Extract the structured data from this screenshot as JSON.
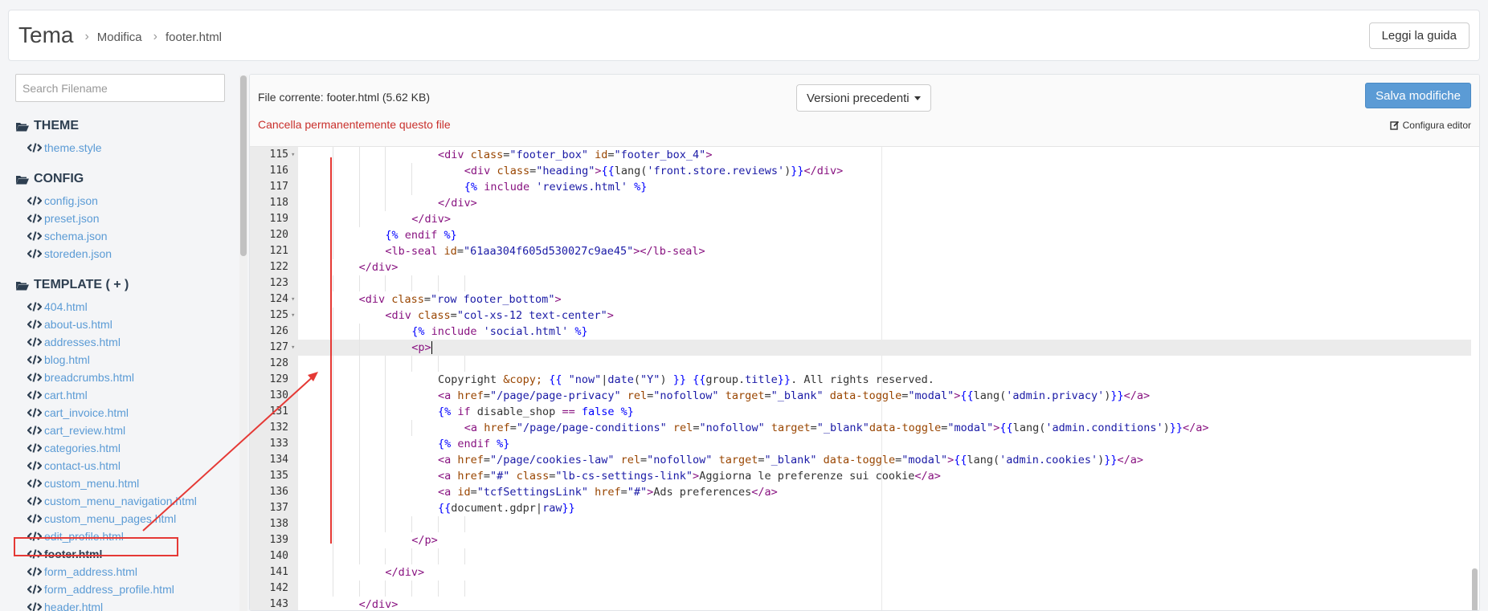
{
  "header": {
    "title": "Tema",
    "breadcrumb": [
      "Modifica",
      "footer.html"
    ],
    "guide_button": "Leggi la guida"
  },
  "sidebar": {
    "search_placeholder": "Search Filename",
    "sections": [
      {
        "label": "THEME",
        "files": [
          "theme.style"
        ]
      },
      {
        "label": "CONFIG",
        "files": [
          "config.json",
          "preset.json",
          "schema.json",
          "storeden.json"
        ]
      },
      {
        "label": "TEMPLATE ( + )",
        "files": [
          "404.html",
          "about-us.html",
          "addresses.html",
          "blog.html",
          "breadcrumbs.html",
          "cart.html",
          "cart_invoice.html",
          "cart_review.html",
          "categories.html",
          "contact-us.html",
          "custom_menu.html",
          "custom_menu_navigation.html",
          "custom_menu_pages.html",
          "edit_profile.html",
          "footer.html",
          "form_address.html",
          "form_address_profile.html",
          "header.html"
        ]
      }
    ],
    "active_file": "footer.html"
  },
  "editor": {
    "file_label": "File corrente:",
    "file_name": "footer.html",
    "file_size": "(5.62 KB)",
    "delete_link": "Cancella permanentemente questo file",
    "versions_button": "Versioni precedenti",
    "save_button": "Salva modifiche",
    "config_link": "Configura editor",
    "active_line": 127,
    "lines": [
      {
        "n": 115,
        "fold": true,
        "indent": 12,
        "tokens": [
          [
            "t",
            "<div "
          ],
          [
            "a",
            "class"
          ],
          [
            "p",
            "="
          ],
          [
            "s",
            "\"footer_box\""
          ],
          [
            "p",
            " "
          ],
          [
            "a",
            "id"
          ],
          [
            "p",
            "="
          ],
          [
            "s",
            "\"footer_box_4\""
          ],
          [
            "t",
            ">"
          ]
        ]
      },
      {
        "n": 116,
        "fold": false,
        "indent": 16,
        "tokens": [
          [
            "t",
            "<div "
          ],
          [
            "a",
            "class"
          ],
          [
            "p",
            "="
          ],
          [
            "s",
            "\"heading\""
          ],
          [
            "t",
            ">"
          ],
          [
            "k",
            "{{"
          ],
          [
            "p",
            "lang("
          ],
          [
            "s",
            "'front.store.reviews'"
          ],
          [
            "p",
            ")"
          ],
          [
            "k",
            "}}"
          ],
          [
            "t",
            "</div>"
          ]
        ]
      },
      {
        "n": 117,
        "fold": false,
        "indent": 16,
        "tokens": [
          [
            "k",
            "{% "
          ],
          [
            "t",
            "include "
          ],
          [
            "s",
            "'reviews.html'"
          ],
          [
            "k",
            " %}"
          ]
        ]
      },
      {
        "n": 118,
        "fold": false,
        "indent": 12,
        "tokens": [
          [
            "t",
            "</div>"
          ]
        ]
      },
      {
        "n": 119,
        "fold": false,
        "indent": 8,
        "tokens": [
          [
            "t",
            "</div>"
          ]
        ]
      },
      {
        "n": 120,
        "fold": false,
        "indent": 4,
        "tokens": [
          [
            "k",
            "{% "
          ],
          [
            "t",
            "endif"
          ],
          [
            "k",
            " %}"
          ]
        ]
      },
      {
        "n": 121,
        "fold": false,
        "indent": 4,
        "tokens": [
          [
            "t",
            "<lb-seal "
          ],
          [
            "a",
            "id"
          ],
          [
            "p",
            "="
          ],
          [
            "s",
            "\"61aa304f605d530027c9ae45\""
          ],
          [
            "t",
            "></lb-seal>"
          ]
        ]
      },
      {
        "n": 122,
        "fold": false,
        "indent": 0,
        "tokens": [
          [
            "t",
            "</div>"
          ]
        ]
      },
      {
        "n": 123,
        "fold": false,
        "indent": 0,
        "tokens": []
      },
      {
        "n": 124,
        "fold": true,
        "indent": 0,
        "tokens": [
          [
            "t",
            "<div "
          ],
          [
            "a",
            "class"
          ],
          [
            "p",
            "="
          ],
          [
            "s",
            "\"row footer_bottom\""
          ],
          [
            "t",
            ">"
          ]
        ]
      },
      {
        "n": 125,
        "fold": true,
        "indent": 4,
        "tokens": [
          [
            "t",
            "<div "
          ],
          [
            "a",
            "class"
          ],
          [
            "p",
            "="
          ],
          [
            "s",
            "\"col-xs-12 text-center\""
          ],
          [
            "t",
            ">"
          ]
        ]
      },
      {
        "n": 126,
        "fold": false,
        "indent": 8,
        "tokens": [
          [
            "k",
            "{% "
          ],
          [
            "t",
            "include "
          ],
          [
            "s",
            "'social.html'"
          ],
          [
            "k",
            " %}"
          ]
        ]
      },
      {
        "n": 127,
        "fold": true,
        "indent": 8,
        "tokens": [
          [
            "t",
            "<p>"
          ]
        ]
      },
      {
        "n": 128,
        "fold": false,
        "indent": 0,
        "tokens": []
      },
      {
        "n": 129,
        "fold": false,
        "indent": 12,
        "tokens": [
          [
            "p",
            "Copyright "
          ],
          [
            "a",
            "&copy;"
          ],
          [
            "p",
            " "
          ],
          [
            "k",
            "{{"
          ],
          [
            "p",
            " "
          ],
          [
            "s",
            "\"now\""
          ],
          [
            "p",
            "|"
          ],
          [
            "s",
            "date"
          ],
          [
            "p",
            "("
          ],
          [
            "s",
            "\"Y\""
          ],
          [
            "p",
            ") "
          ],
          [
            "k",
            "}}"
          ],
          [
            "p",
            " "
          ],
          [
            "k",
            "{{"
          ],
          [
            "p",
            "group."
          ],
          [
            "s",
            "title"
          ],
          [
            "k",
            "}}"
          ],
          [
            "p",
            ". All rights reserved."
          ]
        ]
      },
      {
        "n": 130,
        "fold": false,
        "indent": 12,
        "tokens": [
          [
            "t",
            "<a "
          ],
          [
            "a",
            "href"
          ],
          [
            "p",
            "="
          ],
          [
            "s",
            "\"/page/page-privacy\""
          ],
          [
            "p",
            " "
          ],
          [
            "a",
            "rel"
          ],
          [
            "p",
            "="
          ],
          [
            "s",
            "\"nofollow\""
          ],
          [
            "p",
            " "
          ],
          [
            "a",
            "target"
          ],
          [
            "p",
            "="
          ],
          [
            "s",
            "\"_blank\""
          ],
          [
            "p",
            " "
          ],
          [
            "a",
            "data-toggle"
          ],
          [
            "p",
            "="
          ],
          [
            "s",
            "\"modal\""
          ],
          [
            "t",
            ">"
          ],
          [
            "k",
            "{{"
          ],
          [
            "p",
            "lang("
          ],
          [
            "s",
            "'admin.privacy'"
          ],
          [
            "p",
            ")"
          ],
          [
            "k",
            "}}"
          ],
          [
            "t",
            "</a>"
          ]
        ]
      },
      {
        "n": 131,
        "fold": false,
        "indent": 12,
        "tokens": [
          [
            "k",
            "{% "
          ],
          [
            "t",
            "if "
          ],
          [
            "p",
            "disable_shop "
          ],
          [
            "t",
            "=="
          ],
          [
            "p",
            " "
          ],
          [
            "k",
            "false"
          ],
          [
            "k",
            " %}"
          ]
        ]
      },
      {
        "n": 132,
        "fold": false,
        "indent": 16,
        "tokens": [
          [
            "t",
            "<a "
          ],
          [
            "a",
            "href"
          ],
          [
            "p",
            "="
          ],
          [
            "s",
            "\"/page/page-conditions\""
          ],
          [
            "p",
            " "
          ],
          [
            "a",
            "rel"
          ],
          [
            "p",
            "="
          ],
          [
            "s",
            "\"nofollow\""
          ],
          [
            "p",
            " "
          ],
          [
            "a",
            "target"
          ],
          [
            "p",
            "="
          ],
          [
            "s",
            "\"_blank\""
          ],
          [
            "a",
            "data-toggle"
          ],
          [
            "p",
            "="
          ],
          [
            "s",
            "\"modal\""
          ],
          [
            "t",
            ">"
          ],
          [
            "k",
            "{{"
          ],
          [
            "p",
            "lang("
          ],
          [
            "s",
            "'admin.conditions'"
          ],
          [
            "p",
            ")"
          ],
          [
            "k",
            "}}"
          ],
          [
            "t",
            "</a>"
          ]
        ]
      },
      {
        "n": 133,
        "fold": false,
        "indent": 12,
        "tokens": [
          [
            "k",
            "{% "
          ],
          [
            "t",
            "endif"
          ],
          [
            "k",
            " %}"
          ]
        ]
      },
      {
        "n": 134,
        "fold": false,
        "indent": 12,
        "tokens": [
          [
            "t",
            "<a "
          ],
          [
            "a",
            "href"
          ],
          [
            "p",
            "="
          ],
          [
            "s",
            "\"/page/cookies-law\""
          ],
          [
            "p",
            " "
          ],
          [
            "a",
            "rel"
          ],
          [
            "p",
            "="
          ],
          [
            "s",
            "\"nofollow\""
          ],
          [
            "p",
            " "
          ],
          [
            "a",
            "target"
          ],
          [
            "p",
            "="
          ],
          [
            "s",
            "\"_blank\""
          ],
          [
            "p",
            " "
          ],
          [
            "a",
            "data-toggle"
          ],
          [
            "p",
            "="
          ],
          [
            "s",
            "\"modal\""
          ],
          [
            "t",
            ">"
          ],
          [
            "k",
            "{{"
          ],
          [
            "p",
            "lang("
          ],
          [
            "s",
            "'admin.cookies'"
          ],
          [
            "p",
            ")"
          ],
          [
            "k",
            "}}"
          ],
          [
            "t",
            "</a>"
          ]
        ]
      },
      {
        "n": 135,
        "fold": false,
        "indent": 12,
        "tokens": [
          [
            "t",
            "<a "
          ],
          [
            "a",
            "href"
          ],
          [
            "p",
            "="
          ],
          [
            "s",
            "\"#\""
          ],
          [
            "p",
            " "
          ],
          [
            "a",
            "class"
          ],
          [
            "p",
            "="
          ],
          [
            "s",
            "\"lb-cs-settings-link\""
          ],
          [
            "t",
            ">"
          ],
          [
            "p",
            "Aggiorna le preferenze sui cookie"
          ],
          [
            "t",
            "</a>"
          ]
        ]
      },
      {
        "n": 136,
        "fold": false,
        "indent": 12,
        "tokens": [
          [
            "t",
            "<a "
          ],
          [
            "a",
            "id"
          ],
          [
            "p",
            "="
          ],
          [
            "s",
            "\"tcfSettingsLink\""
          ],
          [
            "p",
            " "
          ],
          [
            "a",
            "href"
          ],
          [
            "p",
            "="
          ],
          [
            "s",
            "\"#\""
          ],
          [
            "t",
            ">"
          ],
          [
            "p",
            "Ads preferences"
          ],
          [
            "t",
            "</a>"
          ]
        ]
      },
      {
        "n": 137,
        "fold": false,
        "indent": 12,
        "tokens": [
          [
            "k",
            "{{"
          ],
          [
            "p",
            "document.gdpr|"
          ],
          [
            "s",
            "raw"
          ],
          [
            "k",
            "}}"
          ]
        ]
      },
      {
        "n": 138,
        "fold": false,
        "indent": 0,
        "tokens": []
      },
      {
        "n": 139,
        "fold": false,
        "indent": 8,
        "tokens": [
          [
            "t",
            "</p>"
          ]
        ]
      },
      {
        "n": 140,
        "fold": false,
        "indent": 0,
        "tokens": []
      },
      {
        "n": 141,
        "fold": false,
        "indent": 4,
        "tokens": [
          [
            "t",
            "</div>"
          ]
        ]
      },
      {
        "n": 142,
        "fold": false,
        "indent": 0,
        "tokens": []
      },
      {
        "n": 143,
        "fold": false,
        "indent": 0,
        "tokens": [
          [
            "t",
            "</div>"
          ]
        ]
      }
    ]
  },
  "colors": {
    "accent": "#5b9bd5",
    "danger": "#c9302c",
    "annotation": "#e53935"
  }
}
